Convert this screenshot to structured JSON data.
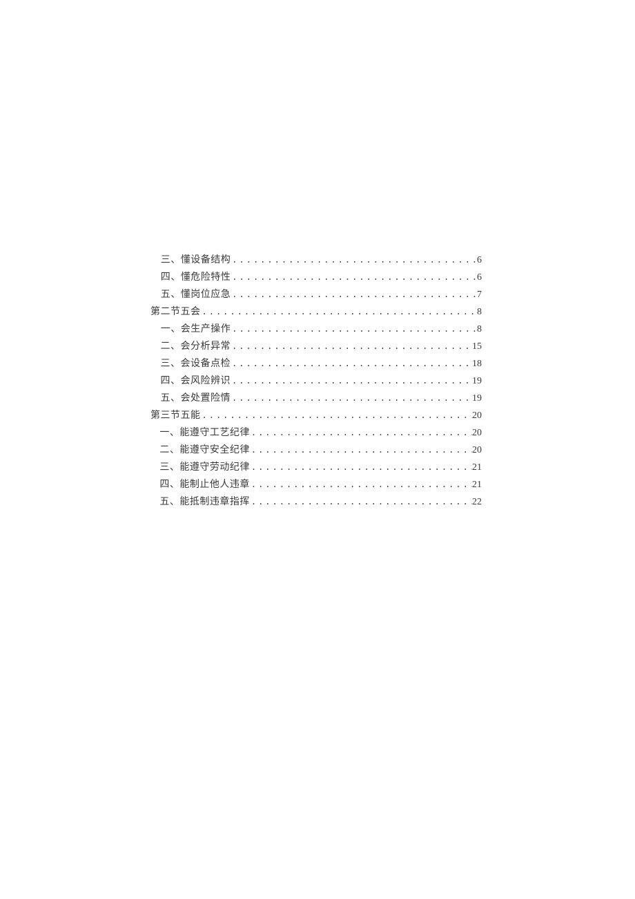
{
  "toc": [
    {
      "indent": 1,
      "title": "三、懂设备结构",
      "page": "6"
    },
    {
      "indent": 1,
      "title": "四、懂危险特性",
      "page": "6"
    },
    {
      "indent": 1,
      "title": "五、懂岗位应急",
      "page": "7"
    },
    {
      "indent": 0,
      "title": "第二节五会",
      "page": "8"
    },
    {
      "indent": 1,
      "title": "一、会生产操作",
      "page": "8"
    },
    {
      "indent": 1,
      "title": "二、会分析异常",
      "page": "15"
    },
    {
      "indent": 1,
      "title": "三、会设备点检",
      "page": "18"
    },
    {
      "indent": 1,
      "title": "四、会风险辨识",
      "page": "19"
    },
    {
      "indent": 1,
      "title": "五、会处置险情",
      "page": "19"
    },
    {
      "indent": 0,
      "title": "第三节五能",
      "page": "20"
    },
    {
      "indent": 1,
      "title": "一、能遵守工艺纪律",
      "page": "20"
    },
    {
      "indent": 1,
      "title": "二、能遵守安全纪律",
      "page": "20"
    },
    {
      "indent": 1,
      "title": "三、能遵守劳动纪律",
      "page": "21"
    },
    {
      "indent": 1,
      "title": "四、能制止他人违章",
      "page": "21"
    },
    {
      "indent": 1,
      "title": "五、能抵制违章指挥",
      "page": "22"
    }
  ]
}
